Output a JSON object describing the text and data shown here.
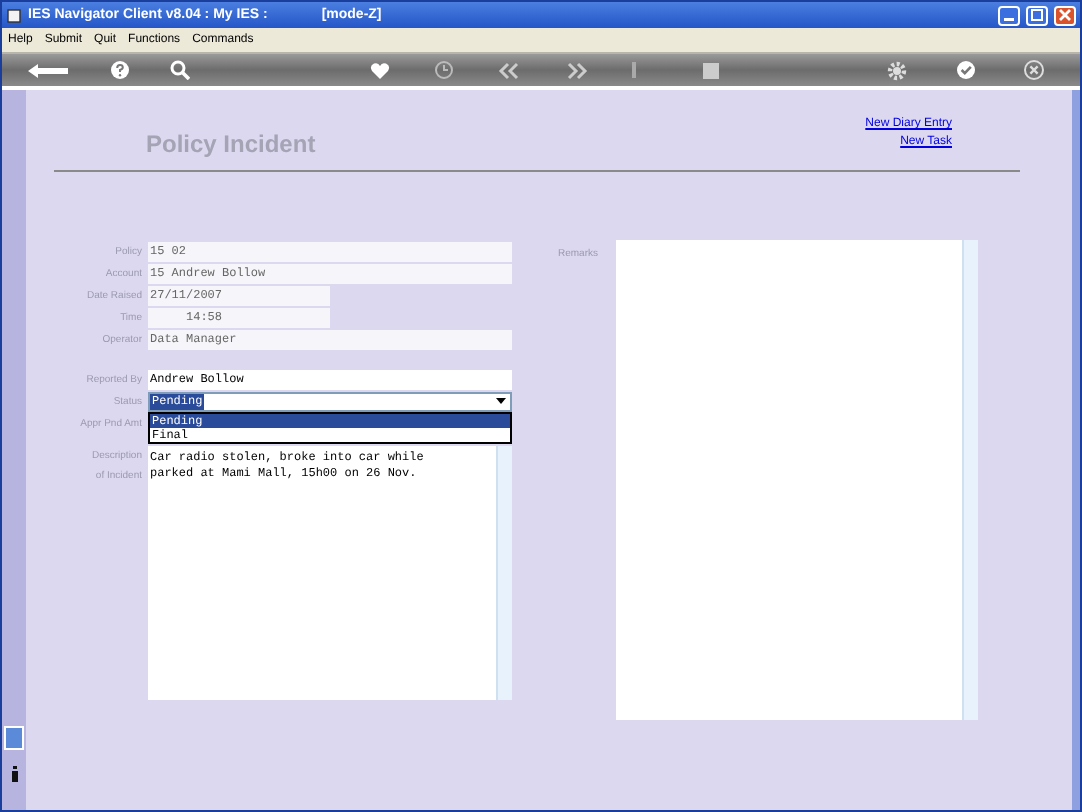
{
  "window": {
    "title": "IES Navigator Client v8.04 : My IES :",
    "mode": "[mode-Z]"
  },
  "menu": [
    "Help",
    "Submit",
    "Quit",
    "Functions",
    "Commands"
  ],
  "toolbar": [
    {
      "kind": "back"
    },
    {
      "kind": "help"
    },
    {
      "kind": "search"
    },
    {
      "kind": "heart"
    },
    {
      "kind": "clock"
    },
    {
      "kind": "rewind"
    },
    {
      "kind": "forward"
    },
    {
      "kind": "bar"
    },
    {
      "kind": "square"
    },
    {
      "kind": "gear"
    },
    {
      "kind": "check"
    },
    {
      "kind": "close"
    }
  ],
  "page": {
    "title": "Policy Incident",
    "links": [
      "New Diary Entry",
      "New Task"
    ]
  },
  "fields": [
    {
      "label": "Policy",
      "value": "15 02",
      "kind": "wide"
    },
    {
      "label": "Account",
      "value": "15 Andrew Bollow",
      "kind": "wide"
    },
    {
      "label": "Date Raised",
      "value": "27/11/2007",
      "kind": "short"
    },
    {
      "label": "Time",
      "value": "     14:58",
      "kind": "short"
    },
    {
      "label": "Operator",
      "value": "Data Manager",
      "kind": "wide"
    }
  ],
  "reported_by": {
    "label": "Reported By",
    "value": "Andrew Bollow"
  },
  "status": {
    "label": "Status",
    "value": "Pending",
    "expanded": true,
    "options": [
      {
        "label": "Pending",
        "selected": true
      },
      {
        "label": "Final",
        "selected": false
      }
    ]
  },
  "appr_pnd_amt": {
    "label": "Appr Pnd Amt"
  },
  "description": {
    "label_lines": [
      "Description",
      "of Incident"
    ],
    "value": "Car radio stolen, broke into car while\nparked at Mami Mall, 15h00 on 26 Nov."
  },
  "remarks": {
    "label": "Remarks"
  }
}
